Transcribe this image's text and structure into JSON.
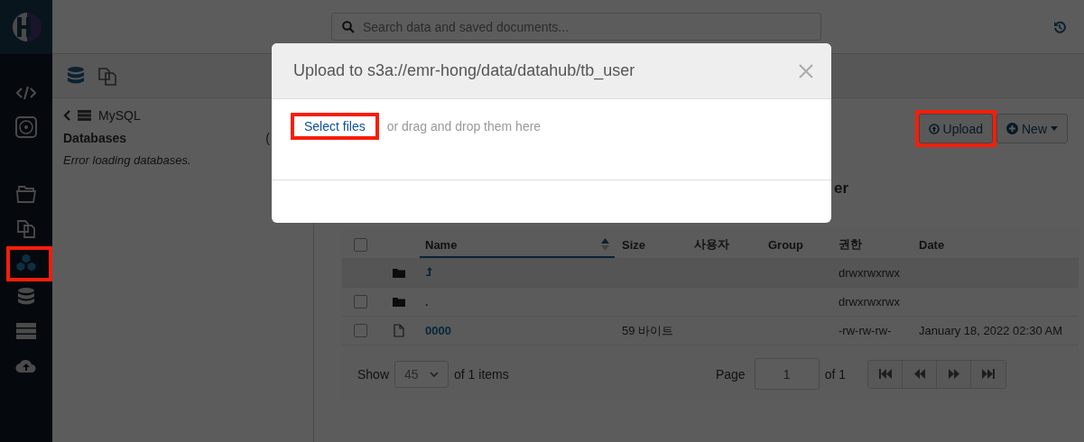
{
  "search": {
    "placeholder": "Search data and saved documents..."
  },
  "nav": [
    {
      "kind": "editor",
      "highlighted": false
    },
    {
      "kind": "dashboard",
      "highlighted": false
    },
    {
      "kind": "files",
      "highlighted": false
    },
    {
      "kind": "documents",
      "highlighted": false
    },
    {
      "kind": "tables",
      "highlighted": true
    },
    {
      "kind": "databases",
      "highlighted": false
    },
    {
      "kind": "jobs",
      "highlighted": false
    },
    {
      "kind": "cloud",
      "highlighted": false
    }
  ],
  "left_panel": {
    "back_label": "MySQL",
    "section": "Databases",
    "section_cut": "(",
    "message": "Error loading databases."
  },
  "toolbar": {
    "upload": {
      "label": "Upload",
      "highlighted": true
    },
    "new": {
      "label": "New"
    }
  },
  "heading_visible": "er",
  "table": {
    "columns": [
      {
        "label": "Name",
        "sorted": true
      },
      {
        "label": "Size",
        "sorted": false
      },
      {
        "label": "사용자",
        "sorted": false
      },
      {
        "label": "Group",
        "sorted": false
      },
      {
        "label": "권한",
        "sorted": false
      },
      {
        "label": "Date",
        "sorted": false
      }
    ],
    "header_checked": false,
    "rows": [
      {
        "kind": "parent",
        "permissions": "drwxrwxrwx"
      },
      {
        "kind": "folder",
        "name": ".",
        "permissions": "drwxrwxrwx",
        "checked": false
      },
      {
        "kind": "file",
        "name": "0000",
        "size": "59 바이트",
        "permissions": "-rw-rw-rw-",
        "date": "January 18, 2022 02:30 AM",
        "checked": false
      }
    ]
  },
  "pagination": {
    "show_label": "Show",
    "page_size": "45",
    "items_label": "of 1 items",
    "page_label": "Page",
    "page": "1",
    "of_pages": "of 1"
  },
  "modal": {
    "title": "Upload to s3a://emr-hong/data/datahub/tb_user",
    "select_label": "Select files",
    "select_highlighted": true,
    "hint": "or drag and drop them here"
  }
}
